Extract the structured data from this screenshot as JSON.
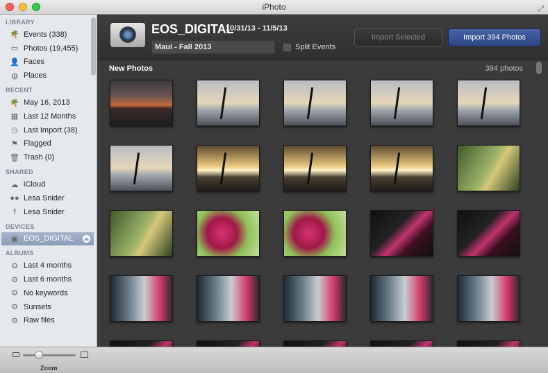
{
  "window": {
    "title": "iPhoto",
    "colors": {
      "close": "#fc605c",
      "minimize": "#fdbc40",
      "zoom": "#34c84a"
    }
  },
  "sidebar": {
    "sections": [
      {
        "title": "LIBRARY",
        "items": [
          {
            "label": "Events (338)",
            "icon": "palm-icon",
            "glyph": "🌴"
          },
          {
            "label": "Photos (19,455)",
            "icon": "photo-icon",
            "glyph": "▭"
          },
          {
            "label": "Faces",
            "icon": "face-icon",
            "glyph": "👤"
          },
          {
            "label": "Places",
            "icon": "globe-icon",
            "glyph": "◍"
          }
        ]
      },
      {
        "title": "RECENT",
        "items": [
          {
            "label": "May 16, 2013",
            "icon": "palm-icon",
            "glyph": "🌴"
          },
          {
            "label": "Last 12 Months",
            "icon": "calendar-icon",
            "glyph": "▦"
          },
          {
            "label": "Last Import (38)",
            "icon": "clock-icon",
            "glyph": "◷"
          },
          {
            "label": "Flagged",
            "icon": "flag-icon",
            "glyph": "⚑"
          },
          {
            "label": "Trash (0)",
            "icon": "trash-icon",
            "glyph": "🗑"
          }
        ]
      },
      {
        "title": "SHARED",
        "items": [
          {
            "label": "iCloud",
            "icon": "cloud-icon",
            "glyph": "☁"
          },
          {
            "label": "Lesa Snider",
            "icon": "flickr-icon",
            "glyph": "●●"
          },
          {
            "label": "Lesa Snider",
            "icon": "facebook-icon",
            "glyph": "f"
          }
        ]
      },
      {
        "title": "DEVICES",
        "items": [
          {
            "label": "EOS_DIGITAL",
            "icon": "camera-icon",
            "glyph": "▣",
            "selected": true
          }
        ]
      },
      {
        "title": "ALBUMS",
        "items": [
          {
            "label": "Last 4 months",
            "icon": "smart-album-icon",
            "glyph": "⚙"
          },
          {
            "label": "Last 6 months",
            "icon": "smart-album-icon",
            "glyph": "⚙"
          },
          {
            "label": "No keywords",
            "icon": "smart-album-icon",
            "glyph": "⚙"
          },
          {
            "label": "Sunsets",
            "icon": "smart-album-icon",
            "glyph": "⚙"
          },
          {
            "label": "Raw files",
            "icon": "smart-album-icon",
            "glyph": "⚙"
          }
        ]
      }
    ]
  },
  "header": {
    "device": "EOS_DIGITAL",
    "dates": "10/31/13 - 11/5/13",
    "event_name": "Maui - Fall 2013",
    "split_events": "Split Events",
    "split_checked": false,
    "import_selected": "Import Selected",
    "import_all": "Import 394 Photos"
  },
  "photos_bar": {
    "title": "New Photos",
    "count": "394 photos"
  },
  "thumbnails": [
    "sunset",
    "palm",
    "palm",
    "palm",
    "palm",
    "palm",
    "palmgold",
    "palmgold",
    "palmgold",
    "leaf",
    "leaf",
    "flower",
    "flower",
    "dark",
    "dark",
    "bird",
    "bird",
    "bird",
    "bird",
    "bird",
    "dark",
    "dark",
    "dark",
    "dark",
    "dark"
  ],
  "bottom": {
    "zoom_label": "Zoom",
    "zoom_level": 0.3
  }
}
